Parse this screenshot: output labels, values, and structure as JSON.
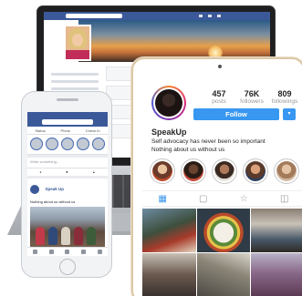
{
  "instagram": {
    "username": "SpeakUp",
    "stats": [
      {
        "value": "457",
        "label": "posts"
      },
      {
        "value": "76K",
        "label": "followers"
      },
      {
        "value": "809",
        "label": "followings"
      }
    ],
    "follow_label": "Follow",
    "dropdown_glyph": "▾",
    "bio_line1": "Self advocacy has never been so important",
    "bio_line2": "Nothing about us without us",
    "tab_icons": [
      "grid-icon",
      "reel-icon",
      "tagged-icon",
      "portrait-icon"
    ],
    "tab_glyphs": [
      "▦",
      "▢",
      "☆",
      "◫"
    ],
    "accent_color": "#3897f0"
  },
  "facebook_phone": {
    "tabs": [
      "Status",
      "Photo",
      "Check In"
    ],
    "post_prompt": "Write something...",
    "post_author": "Speak Up",
    "post_text": "Nothing about us without us",
    "brand_color": "#3b5998"
  }
}
